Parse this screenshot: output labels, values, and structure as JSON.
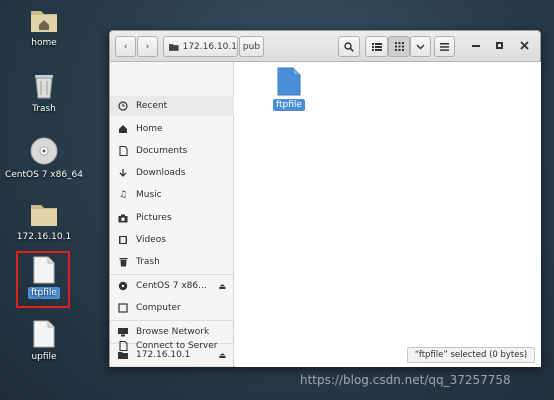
{
  "desktop": {
    "icons": [
      {
        "label": "home",
        "icon": "folder-home-icon"
      },
      {
        "label": "Trash",
        "icon": "trash-icon"
      },
      {
        "label": "CentOS 7 x86_64",
        "icon": "cdrom-icon"
      },
      {
        "label": "172.16.10.1",
        "icon": "network-folder-icon"
      },
      {
        "label": "ftpfile",
        "icon": "text-file-icon",
        "selected": true
      },
      {
        "label": "upfile",
        "icon": "text-file-icon"
      }
    ]
  },
  "window": {
    "path": {
      "server": "172.16.10.1",
      "folder": "pub"
    },
    "sidebar": {
      "items": [
        {
          "label": "Recent",
          "icon": "clock-icon"
        },
        {
          "label": "Home",
          "icon": "home-icon"
        },
        {
          "label": "Documents",
          "icon": "document-icon"
        },
        {
          "label": "Downloads",
          "icon": "download-icon"
        },
        {
          "label": "Music",
          "icon": "music-icon"
        },
        {
          "label": "Pictures",
          "icon": "camera-icon"
        },
        {
          "label": "Videos",
          "icon": "video-icon"
        },
        {
          "label": "Trash",
          "icon": "trash-icon"
        },
        {
          "label": "CentOS 7 x86...",
          "icon": "disc-icon",
          "eject": true
        },
        {
          "label": "Computer",
          "icon": "computer-icon"
        },
        {
          "label": "Browse Network",
          "icon": "network-icon"
        },
        {
          "label": "172.16.10.1",
          "icon": "folder-icon",
          "eject": true
        },
        {
          "label": "Connect to Server",
          "icon": "server-icon"
        }
      ]
    },
    "files": [
      {
        "label": "ftpfile",
        "selected": true,
        "icon": "text-file-icon"
      }
    ],
    "status": "“ftpfile” selected (0 bytes)"
  },
  "watermark": "https://blog.csdn.net/qq_37257758",
  "colors": {
    "selection": "#4a90d9",
    "highlight_box": "#e02020"
  }
}
